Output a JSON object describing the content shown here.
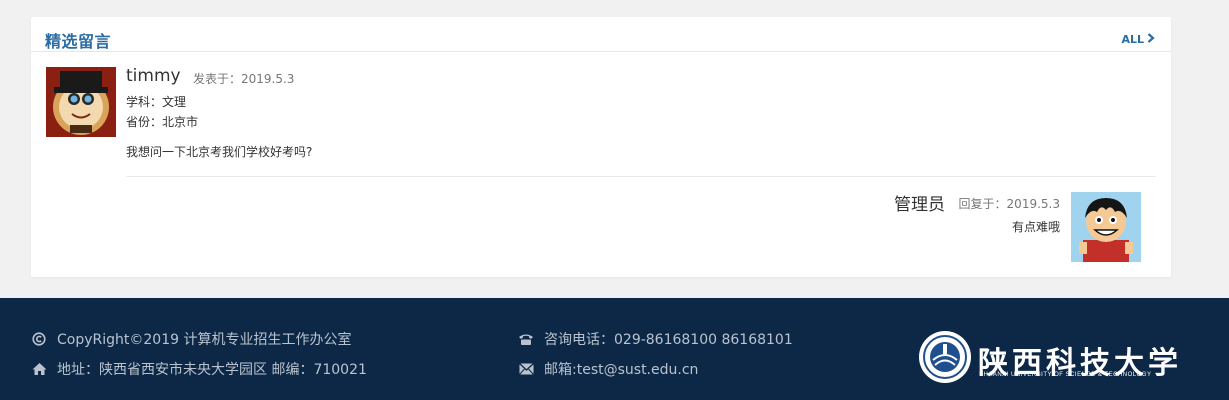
{
  "section": {
    "title": "精选留言",
    "all_label": "ALL"
  },
  "question": {
    "user": "timmy",
    "time": "发表于：2019.5.3",
    "subject": "学科：文理",
    "province": "省份：北京市",
    "content": "我想问一下北京考我们学校好考吗?"
  },
  "answer": {
    "user": "管理员",
    "time": "回复于：2019.5.3",
    "content": "有点难哦"
  },
  "footer": {
    "copyright": "CopyRight©2019 计算机专业招生工作办公室",
    "address": "地址：陕西省西安市未央大学园区 邮编：710021",
    "phone": "咨询电话：029-86168100 86168101",
    "email": "邮箱:test@sust.edu.cn"
  },
  "logo": {
    "title": "陕西科技大学",
    "subtitle": "SHAANXI UNIVERSITY OF SCIENCE & TECHNOLOGY"
  },
  "colors": {
    "accent": "#2b6ca3",
    "footer_bg": "#0d2846",
    "page_bg": "#f1f1f1"
  },
  "icons": {
    "all_link": "chevron-right-icon",
    "copyright": "copyright-icon",
    "address": "home-icon",
    "phone": "phone-icon",
    "email": "envelope-icon"
  }
}
